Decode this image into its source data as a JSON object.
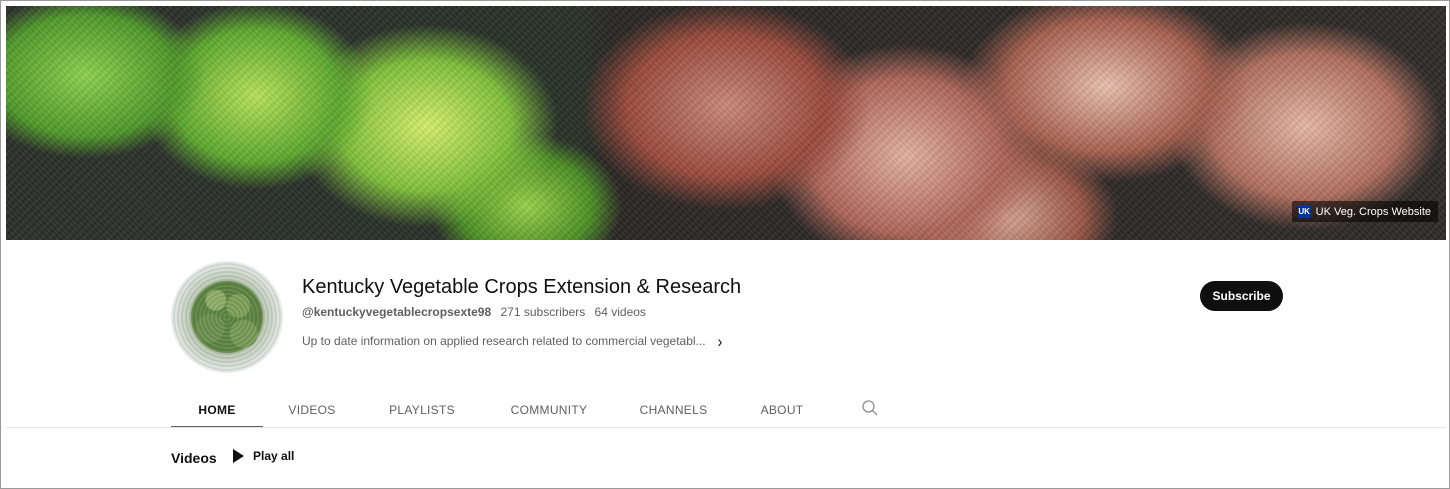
{
  "banner": {
    "link_label": "UK Veg. Crops Website",
    "link_icon": "uk-logo-icon"
  },
  "channel": {
    "name": "Kentucky Vegetable Crops Extension & Research",
    "handle": "@kentuckyvegetablecropsexte98",
    "subscribers": "271 subscribers",
    "videos": "64 videos",
    "description": "Up to date information on applied research related to commercial vegetabl...",
    "description_more_icon": "chevron-right-icon",
    "avatar_icon": "broccoli-avatar"
  },
  "actions": {
    "subscribe_label": "Subscribe"
  },
  "tabs": [
    {
      "label": "HOME",
      "active": true
    },
    {
      "label": "VIDEOS",
      "active": false
    },
    {
      "label": "PLAYLISTS",
      "active": false
    },
    {
      "label": "COMMUNITY",
      "active": false
    },
    {
      "label": "CHANNELS",
      "active": false
    },
    {
      "label": "ABOUT",
      "active": false
    }
  ],
  "tabs_search_icon": "search-icon",
  "section": {
    "title": "Videos",
    "play_all_label": "Play all",
    "play_icon": "play-icon"
  },
  "colors": {
    "subscribe_bg": "#0f0f0f",
    "text_primary": "#0f0f0f",
    "text_secondary": "#606060",
    "uk_blue": "#0033a0"
  }
}
